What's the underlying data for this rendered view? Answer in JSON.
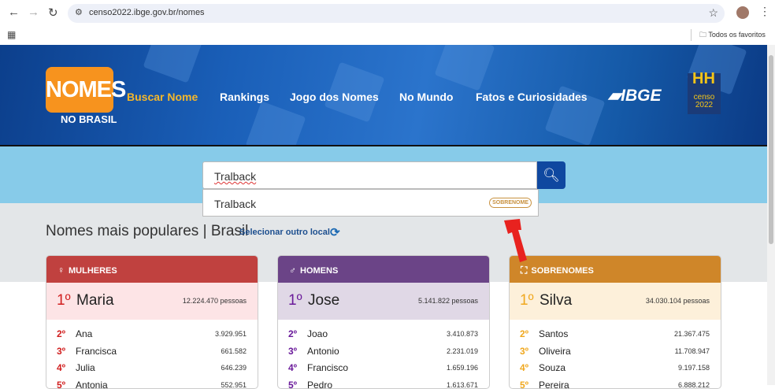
{
  "browser": {
    "url": "censo2022.ibge.gov.br/nomes",
    "bookmarks_label": "Todos os favoritos"
  },
  "header": {
    "logo_top": "NOMES",
    "logo_bottom": "NO BRASIL",
    "nav": [
      "Buscar Nome",
      "Rankings",
      "Jogo dos Nomes",
      "No Mundo",
      "Fatos e Curiosidades"
    ],
    "ibge": "IBGE",
    "censo": "censo",
    "censo_year": "2022"
  },
  "search": {
    "value": "Tralback",
    "suggestion": "Tralback",
    "suggestion_badge": "SOBRENOME"
  },
  "popular": {
    "title": "Nomes mais populares | ",
    "location": "Brasil",
    "select_label": "Selecionar outro local"
  },
  "cards": [
    {
      "title": "MULHERES",
      "icon": "♀",
      "color": "#c0413f",
      "top_bg": "#fde4e6",
      "rank_color": "#d11f1f",
      "first": {
        "rank": "1º",
        "name": "Maria",
        "count": "12.224.470 pessoas"
      },
      "rows": [
        {
          "rank": "2º",
          "name": "Ana",
          "count": "3.929.951"
        },
        {
          "rank": "3º",
          "name": "Francisca",
          "count": "661.582"
        },
        {
          "rank": "4º",
          "name": "Julia",
          "count": "646.239"
        },
        {
          "rank": "5º",
          "name": "Antonia",
          "count": "552.951"
        }
      ]
    },
    {
      "title": "HOMENS",
      "icon": "♂",
      "color": "#6b4487",
      "top_bg": "#e0d8e6",
      "rank_color": "#6a1a9a",
      "first": {
        "rank": "1º",
        "name": "Jose",
        "count": "5.141.822 pessoas"
      },
      "rows": [
        {
          "rank": "2º",
          "name": "Joao",
          "count": "3.410.873"
        },
        {
          "rank": "3º",
          "name": "Antonio",
          "count": "2.231.019"
        },
        {
          "rank": "4º",
          "name": "Francisco",
          "count": "1.659.196"
        },
        {
          "rank": "5º",
          "name": "Pedro",
          "count": "1.613.671"
        }
      ]
    },
    {
      "title": "SOBRENOMES",
      "icon": "⛶",
      "color": "#cf8629",
      "top_bg": "#fdf0da",
      "rank_color": "#f0a81e",
      "first": {
        "rank": "1º",
        "name": "Silva",
        "count": "34.030.104 pessoas"
      },
      "rows": [
        {
          "rank": "2º",
          "name": "Santos",
          "count": "21.367.475"
        },
        {
          "rank": "3º",
          "name": "Oliveira",
          "count": "11.708.947"
        },
        {
          "rank": "4º",
          "name": "Souza",
          "count": "9.197.158"
        },
        {
          "rank": "5º",
          "name": "Pereira",
          "count": "6.888.212"
        }
      ]
    }
  ]
}
